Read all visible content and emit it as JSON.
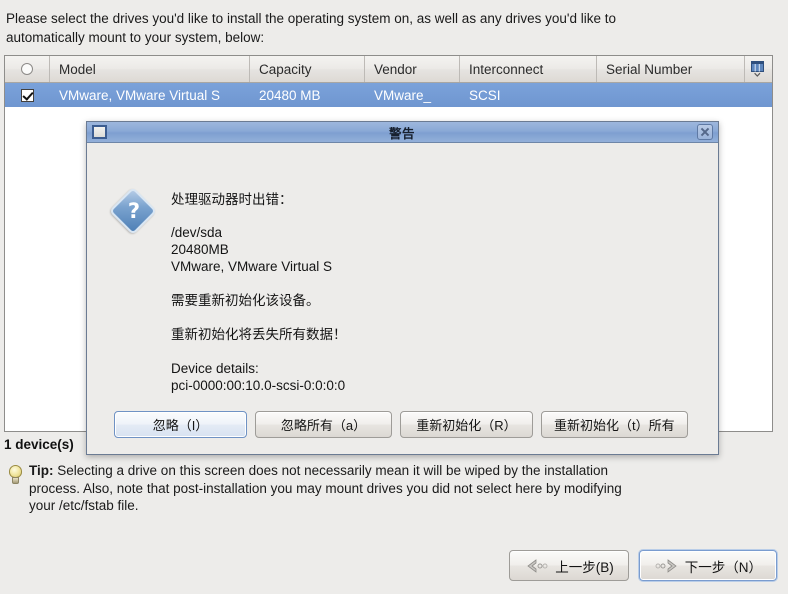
{
  "page": {
    "intro_text": "Please select the drives you'd like to install the operating system on, as well as any drives you'd like to automatically mount to your system, below:",
    "device_count": "1 device(s)",
    "selection_color": "#6f96d0",
    "background_color": "#edecea"
  },
  "table": {
    "columns": [
      {
        "key": "check",
        "label": ""
      },
      {
        "key": "model",
        "label": "Model"
      },
      {
        "key": "capacity",
        "label": "Capacity"
      },
      {
        "key": "vendor",
        "label": "Vendor"
      },
      {
        "key": "interconnect",
        "label": "Interconnect"
      },
      {
        "key": "serial",
        "label": "Serial Number"
      },
      {
        "key": "tools",
        "label": ""
      }
    ],
    "header_select_all_icon": "radio-unchecked-icon",
    "column_chooser_icon": "column-chooser-icon",
    "rows": [
      {
        "checked": true,
        "model": "VMware, VMware Virtual S",
        "capacity": "20480 MB",
        "vendor": "VMware_",
        "interconnect": "SCSI",
        "serial": "",
        "selected": true
      }
    ]
  },
  "tip": {
    "icon": "lightbulb-icon",
    "label": "Tip:",
    "text": " Selecting a drive on this screen does not necessarily mean it will be wiped by the installation process.  Also, note that post-installation you may mount drives you did not select here by modifying your /etc/fstab file."
  },
  "nav": {
    "back_label": "上一步(B)",
    "next_label": "下一步（N）",
    "back_icon": "chevron-left-icon",
    "next_icon": "chevron-right-icon"
  },
  "dialog": {
    "title": "警告",
    "window_icon": "window-menu-icon",
    "close_icon": "close-icon",
    "severity_icon": "question-diamond-icon",
    "lines": [
      "处理驱动器时出错：",
      "",
      "/dev/sda",
      "20480MB",
      "VMware, VMware Virtual S",
      "",
      "需要重新初始化该设备。",
      "",
      "重新初始化将丢失所有数据！",
      "",
      "Device details:",
      "pci-0000:00:10.0-scsi-0:0:0:0"
    ],
    "buttons": [
      {
        "label": "忽略（I）",
        "default": true
      },
      {
        "label": "忽略所有（a）",
        "default": false
      },
      {
        "label": "重新初始化（R）",
        "default": false
      },
      {
        "label": "重新初始化（t）所有",
        "default": false
      }
    ]
  }
}
